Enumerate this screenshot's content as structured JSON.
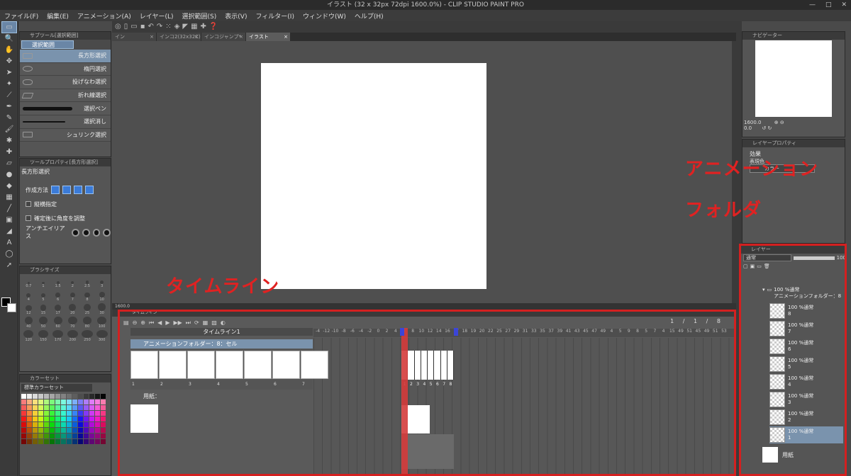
{
  "window": {
    "title": "イラスト (32 x 32px 72dpi 1600.0%)  - CLIP STUDIO PAINT PRO",
    "controls": [
      "—",
      "□",
      "✕"
    ]
  },
  "menu": [
    "ファイル(F)",
    "編集(E)",
    "アニメーション(A)",
    "レイヤー(L)",
    "選択範囲(S)",
    "表示(V)",
    "フィルター(I)",
    "ウィンドウ(W)",
    "ヘルプ(H)"
  ],
  "subtool": {
    "header": "サブツール[選択範囲]",
    "tab": "選択範囲",
    "items": [
      {
        "label": "長方形選択",
        "selected": true
      },
      {
        "label": "楕円選択",
        "selected": false
      },
      {
        "label": "投げなわ選択",
        "selected": false
      },
      {
        "label": "折れ線選択",
        "selected": false
      },
      {
        "label": "選択ペン",
        "selected": false
      },
      {
        "label": "選択消し",
        "selected": false
      },
      {
        "label": "シュリンク選択",
        "selected": false
      }
    ]
  },
  "toolprop": {
    "header": "ツールプロパティ[長方形選択]",
    "title": "長方形選択",
    "rows": {
      "mode": "作成方法",
      "aspect": "縦横指定",
      "angle": "確定後に角度を調整",
      "aa": "アンチエイリアス"
    }
  },
  "brushsize": {
    "header": "ブラシサイズ",
    "sizes": [
      "0.7",
      "1",
      "1.5",
      "2",
      "2.5",
      "3",
      "4",
      "5",
      "6",
      "7",
      "8",
      "10",
      "12",
      "15",
      "17",
      "20",
      "25",
      "30",
      "40",
      "50",
      "60",
      "70",
      "80",
      "100",
      "120",
      "150",
      "170",
      "200",
      "250",
      "300"
    ]
  },
  "colorset": {
    "header": "カラーセット",
    "selected": "標準カラーセット"
  },
  "doctabs": [
    {
      "label": "イン",
      "active": false
    },
    {
      "label": "インコ2(32x32C)",
      "active": false
    },
    {
      "label": "インコジャンプ*",
      "active": false
    },
    {
      "label": "イラスト",
      "active": true
    }
  ],
  "canvas": {
    "zoom": "1600.0"
  },
  "timeline": {
    "header": "タイムライン",
    "name": "タイムライン1",
    "counter": [
      "1",
      "/",
      "1",
      "/",
      "8"
    ],
    "folder_row": "アニメーションフォルダー：8：セル",
    "paper_row": "用紙：",
    "cell_numbers": [
      "1",
      "2",
      "3",
      "4",
      "5",
      "6",
      "7"
    ],
    "ruler": [
      "-4",
      "-12",
      "-10",
      "-8",
      "-6",
      "-4",
      "-2",
      "0",
      "2",
      "4",
      "6",
      "8",
      "10",
      "12",
      "14",
      "16",
      "17",
      "18",
      "19",
      "20",
      "22",
      "25",
      "27",
      "29",
      "31",
      "33",
      "35",
      "37",
      "39",
      "41",
      "43",
      "45",
      "47",
      "49",
      "4",
      "5",
      "9",
      "8",
      "5",
      "7",
      "4",
      "15",
      "49",
      "51",
      "45",
      "49",
      "51",
      "53"
    ],
    "frame_numbers": [
      "1",
      "2",
      "3",
      "4",
      "5",
      "6",
      "7",
      "8"
    ],
    "ruler_marks": [
      "1",
      "8",
      "5",
      "7",
      "4"
    ]
  },
  "navigator": {
    "header": "ナビゲーター",
    "zoom": "1600.0",
    "angle": "0.0"
  },
  "layerprop": {
    "header": "レイヤープロパティ",
    "effect": "効果",
    "color_label": "表現色",
    "color_value": "カラー"
  },
  "layers": {
    "header": "レイヤー",
    "blend": "通常",
    "opacity": "100",
    "folder": {
      "line1": "100 %通常",
      "line2": "アニメーションフォルダー：8"
    },
    "items": [
      {
        "blend": "100 %通常",
        "name": "8",
        "active": false
      },
      {
        "blend": "100 %通常",
        "name": "7",
        "active": false
      },
      {
        "blend": "100 %通常",
        "name": "6",
        "active": false
      },
      {
        "blend": "100 %通常",
        "name": "5",
        "active": false
      },
      {
        "blend": "100 %通常",
        "name": "4",
        "active": false
      },
      {
        "blend": "100 %通常",
        "name": "3",
        "active": false
      },
      {
        "blend": "100 %通常",
        "name": "2",
        "active": false
      },
      {
        "blend": "100 %通常",
        "name": "1",
        "active": true
      }
    ],
    "paper": "用紙"
  },
  "annotations": {
    "timeline": "タイムライン",
    "folder_line1": "アニメーション",
    "folder_line2": "フォルダ",
    "color": "#e02222"
  }
}
